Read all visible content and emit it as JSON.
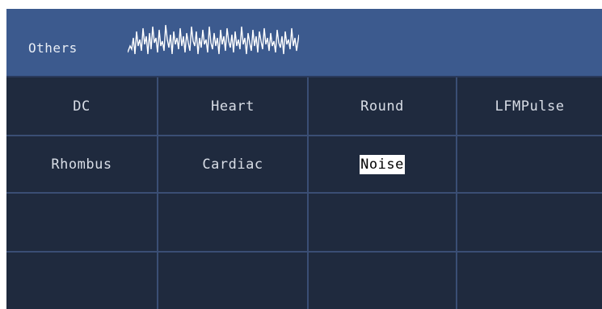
{
  "header": {
    "title": "Others",
    "icon": "noise-waveform-icon"
  },
  "cells": [
    {
      "label": "DC",
      "selected": false
    },
    {
      "label": "Heart",
      "selected": false
    },
    {
      "label": "Round",
      "selected": false
    },
    {
      "label": "LFMPulse",
      "selected": false
    },
    {
      "label": "Rhombus",
      "selected": false
    },
    {
      "label": "Cardiac",
      "selected": false
    },
    {
      "label": "Noise",
      "selected": true
    },
    {
      "label": "",
      "selected": false
    },
    {
      "label": "",
      "selected": false
    },
    {
      "label": "",
      "selected": false
    },
    {
      "label": "",
      "selected": false
    },
    {
      "label": "",
      "selected": false
    },
    {
      "label": "",
      "selected": false
    },
    {
      "label": "",
      "selected": false
    },
    {
      "label": "",
      "selected": false
    },
    {
      "label": "",
      "selected": false
    }
  ],
  "colors": {
    "panel_bg": "#1f2a3e",
    "header_bg": "#3c5a8e",
    "grid_line": "#3a4e74",
    "text": "#d8dde6",
    "selected_bg": "#ffffff",
    "selected_text": "#000000"
  }
}
